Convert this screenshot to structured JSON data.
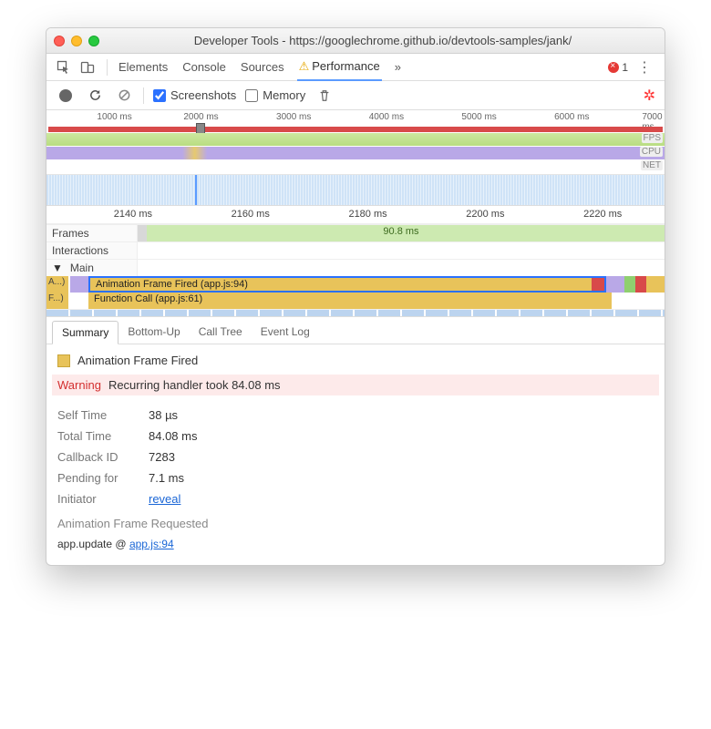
{
  "window": {
    "title": "Developer Tools - https://googlechrome.github.io/devtools-samples/jank/"
  },
  "tabs": {
    "items": [
      "Elements",
      "Console",
      "Sources",
      "Performance"
    ],
    "active_index": 3,
    "overflow_glyph": "»",
    "error_count": "1"
  },
  "toolbar": {
    "screenshots_label": "Screenshots",
    "screenshots_checked": true,
    "memory_label": "Memory",
    "memory_checked": false
  },
  "overview": {
    "tick_labels": [
      "1000 ms",
      "2000 ms",
      "3000 ms",
      "4000 ms",
      "5000 ms",
      "6000 ms",
      "7000 ms"
    ],
    "lane_labels": {
      "fps": "FPS",
      "cpu": "CPU",
      "net": "NET"
    }
  },
  "detail": {
    "tick_labels": [
      "2140 ms",
      "2160 ms",
      "2180 ms",
      "2200 ms",
      "2220 ms"
    ],
    "tracks": {
      "frames_label": "Frames",
      "frames_value": "90.8 ms",
      "interactions_label": "Interactions",
      "main_label": "Main",
      "stub_a": "A...)",
      "stub_f": "F...)",
      "bar1": "Animation Frame Fired (app.js:94)",
      "bar2": "Function Call (app.js:61)"
    }
  },
  "bottom_tabs": {
    "items": [
      "Summary",
      "Bottom-Up",
      "Call Tree",
      "Event Log"
    ],
    "active_index": 0
  },
  "summary": {
    "event_name": "Animation Frame Fired",
    "warning_label": "Warning",
    "warning_text": "Recurring handler took 84.08 ms",
    "rows": {
      "self_time": {
        "k": "Self Time",
        "v": "38 µs"
      },
      "total_time": {
        "k": "Total Time",
        "v": "84.08 ms"
      },
      "callback_id": {
        "k": "Callback ID",
        "v": "7283"
      },
      "pending_for": {
        "k": "Pending for",
        "v": "7.1 ms"
      },
      "initiator": {
        "k": "Initiator",
        "v": "reveal"
      }
    },
    "afr_label": "Animation Frame Requested",
    "stack_fn": "app.update",
    "stack_at": "@",
    "stack_link": "app.js:94"
  }
}
